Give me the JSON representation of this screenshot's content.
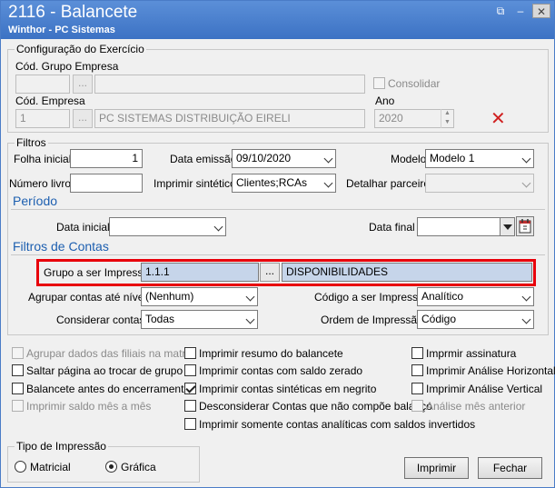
{
  "window": {
    "title": "2116 - Balancete",
    "subtitle": "Winthor - PC Sistemas",
    "controls": [
      "restore-icon",
      "minimize-icon",
      "close-icon"
    ]
  },
  "config": {
    "group_title": "Configuração do Exercício",
    "grupo_empresa_label": "Cód. Grupo Empresa",
    "grupo_empresa_code": "",
    "grupo_empresa_name": "",
    "consolidar_label": "Consolidar",
    "consolidar_checked": false,
    "empresa_label": "Cód. Empresa",
    "empresa_code": "1",
    "empresa_name": "PC SISTEMAS DISTRIBUIÇÃO  EIRELI",
    "ano_label": "Ano",
    "ano_value": "2020",
    "dots": "..."
  },
  "filtros": {
    "group_title": "Filtros",
    "folha_inicial_label": "Folha inicial",
    "folha_inicial_value": "1",
    "data_emissao_label": "Data emissão",
    "data_emissao_value": "09/10/2020",
    "modelo_label": "Modelo",
    "modelo_value": "Modelo 1",
    "numero_livro_label": "Número livro",
    "numero_livro_value": "",
    "imprimir_sintetico_label": "Imprimir sintético",
    "imprimir_sintetico_value": "Clientes;RCAs",
    "detalhar_parceiro_label": "Detalhar parceiro",
    "detalhar_parceiro_value": ""
  },
  "periodo": {
    "section_title": "Período",
    "data_inicial_label": "Data inicial",
    "data_inicial_value": "",
    "data_final_label": "Data final",
    "data_final_value": ""
  },
  "filtros_contas": {
    "section_title": "Filtros de Contas",
    "grupo_label": "Grupo a ser Impresso",
    "grupo_code": "1.1.1",
    "grupo_desc": "DISPONIBILIDADES",
    "dots": "...",
    "agrupar_label": "Agrupar contas até nível",
    "agrupar_value": "(Nenhum)",
    "codigo_label": "Código a ser Impresso",
    "codigo_value": "Analítico",
    "considerar_label": "Considerar contas",
    "considerar_value": "Todas",
    "ordem_label": "Ordem de Impressão",
    "ordem_value": "Código"
  },
  "options": {
    "col1": [
      {
        "label": "Agrupar dados das filiais na matriz",
        "checked": false,
        "disabled": true
      },
      {
        "label": "Saltar página ao trocar de grupo",
        "checked": false,
        "disabled": false
      },
      {
        "label": "Balancete antes do encerramento",
        "checked": false,
        "disabled": false
      },
      {
        "label": "Imprimir saldo mês a mês",
        "checked": false,
        "disabled": true
      }
    ],
    "col2": [
      {
        "label": "Imprimir resumo do balancete",
        "checked": false,
        "disabled": false
      },
      {
        "label": "Imprimir contas com saldo zerado",
        "checked": false,
        "disabled": false
      },
      {
        "label": "Imprimir contas sintéticas em negrito",
        "checked": true,
        "disabled": false
      },
      {
        "label": "Desconsiderar Contas que não compõe balanço",
        "checked": false,
        "disabled": false
      },
      {
        "label": "Imprimir somente contas analíticas com saldos invertidos",
        "checked": false,
        "disabled": false
      }
    ],
    "col3": [
      {
        "label": "Imprmir assinatura",
        "checked": false,
        "disabled": false
      },
      {
        "label": "Imprimir Análise Horizontal",
        "checked": false,
        "disabled": false
      },
      {
        "label": "Imprimir Análise Vertical",
        "checked": false,
        "disabled": false
      },
      {
        "label": "Análise mês anterior",
        "checked": false,
        "disabled": true
      }
    ]
  },
  "tipo_impressao": {
    "group_title": "Tipo de Impressão",
    "matricial_label": "Matricial",
    "grafica_label": "Gráfica",
    "selected": "Gráfica"
  },
  "buttons": {
    "imprimir": "Imprimir",
    "fechar": "Fechar"
  },
  "colors": {
    "titlebar": "#3c72c4",
    "section": "#1d5fb0",
    "highlight": "#e8000b"
  }
}
